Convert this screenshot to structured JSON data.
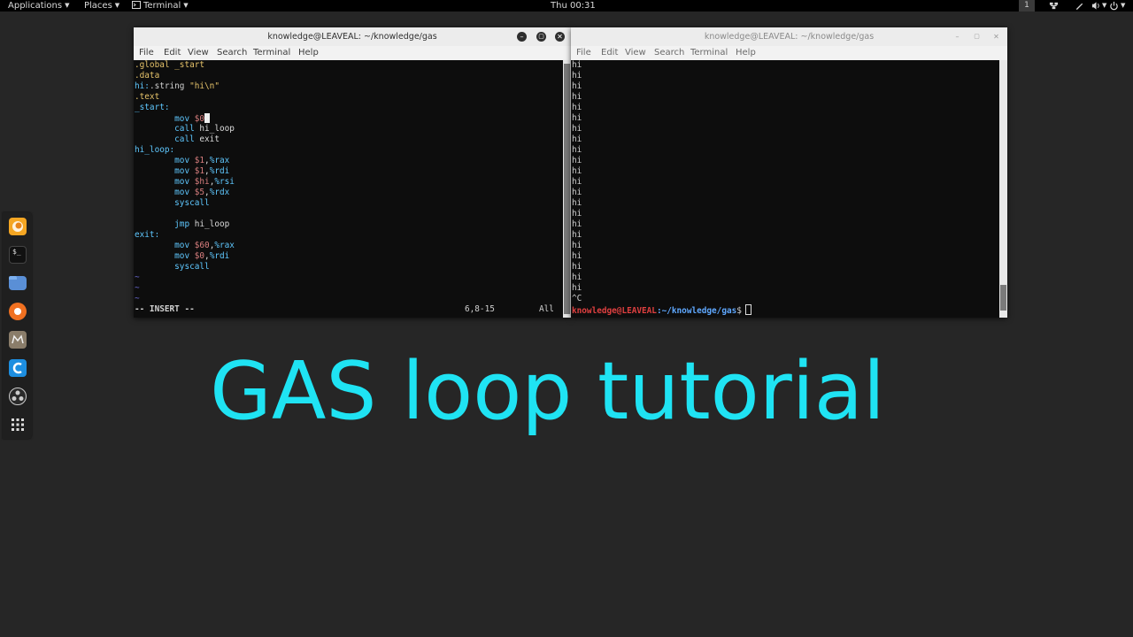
{
  "topbar": {
    "applications": "Applications",
    "places": "Places",
    "terminal": "Terminal",
    "clock": "Thu 00:31",
    "workspace": "1",
    "icons": [
      "network-icon",
      "pen-icon",
      "volume-icon",
      "power-icon"
    ]
  },
  "dock": {
    "items": [
      "firefox-icon",
      "terminal-icon",
      "files-icon",
      "burp-icon",
      "metasploit-icon",
      "cherrytree-icon",
      "obs-icon",
      "app-grid-icon"
    ]
  },
  "left_window": {
    "title": "knowledge@LEAVEAL: ~/knowledge/gas",
    "menu": [
      "File",
      "Edit",
      "View",
      "Search",
      "Terminal",
      "Help"
    ],
    "code": [
      ".global _start",
      ".data",
      "hi:.string \"hi\\n\"",
      ".text",
      "_start:",
      "        mov $0",
      "        call hi_loop",
      "        call exit",
      "hi_loop:",
      "        mov $1,%rax",
      "        mov $1,%rdi",
      "        mov $hi,%rsi",
      "        mov $5,%rdx",
      "        syscall",
      "",
      "        jmp hi_loop",
      "exit:",
      "        mov $60,%rax",
      "        mov $0,%rdi",
      "        syscall",
      "~",
      "~",
      "~"
    ],
    "status_mode": "-- INSERT --",
    "status_pos": "6,8-15",
    "status_scroll": "All"
  },
  "right_window": {
    "title": "knowledge@LEAVEAL: ~/knowledge/gas",
    "menu": [
      "File",
      "Edit",
      "View",
      "Search",
      "Terminal",
      "Help"
    ],
    "output_line": "hi",
    "output_count": 22,
    "interrupt": "^C",
    "prompt_user": "knowledge@LEAVEAL",
    "prompt_path": ":~/knowledge/gas",
    "prompt_symbol": "$"
  },
  "headline": "GAS loop tutorial",
  "colors": {
    "headline": "#1fe3f3",
    "background": "#262626",
    "keyword": "#5fc8ff",
    "string": "#e6c36a",
    "prompt_user": "#e04040",
    "prompt_path": "#5fa8ff"
  }
}
